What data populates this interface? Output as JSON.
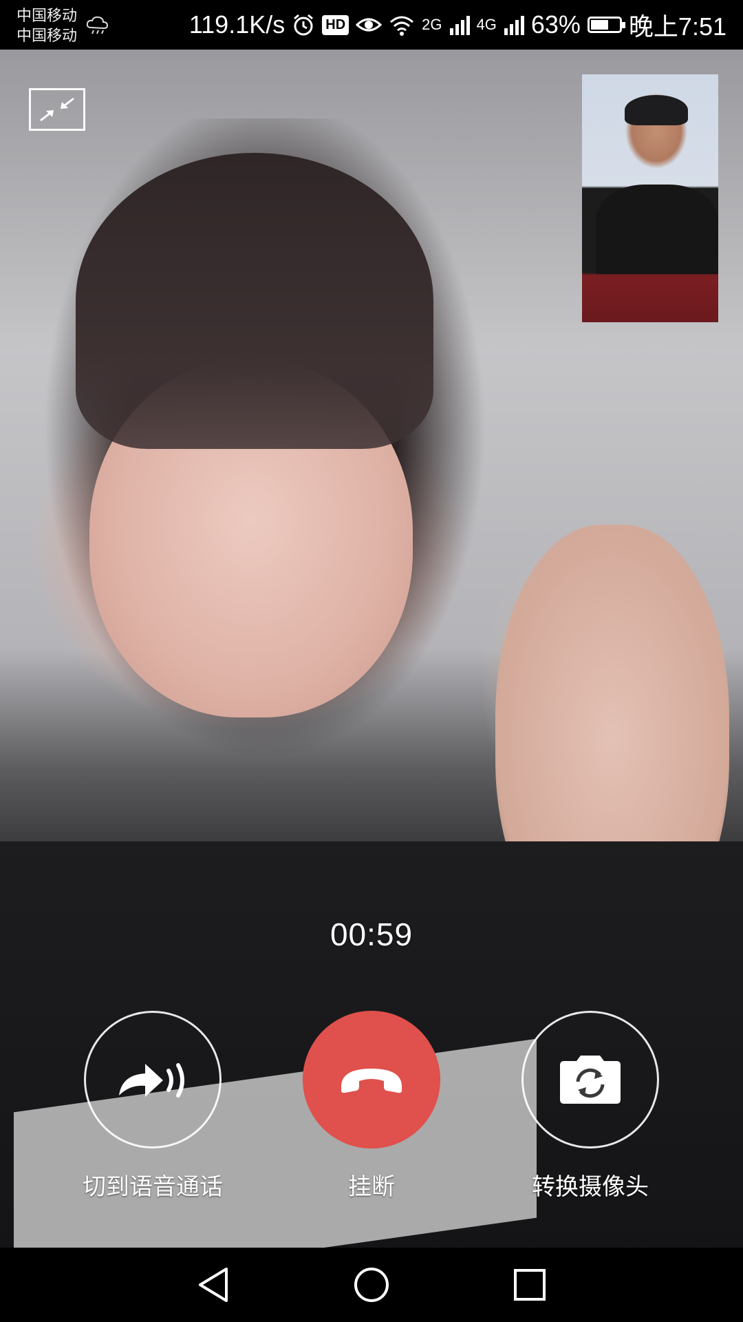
{
  "status_bar": {
    "carrier_1": "中国移动",
    "carrier_2": "中国移动",
    "network_speed": "119.1K/s",
    "hd_badge": "HD",
    "signal_1_label": "2G",
    "signal_2_label": "4G",
    "battery_percent": "63%",
    "battery_level": 0.63,
    "time": "晚上7:51",
    "icons": [
      "weather-rain-icon",
      "alarm-icon",
      "hd-icon",
      "eye-icon",
      "wifi-icon",
      "signal-icon",
      "battery-icon"
    ]
  },
  "call": {
    "timer": "00:59"
  },
  "controls": {
    "switch_to_voice_label": "切到语音通话",
    "hang_up_label": "挂断",
    "switch_camera_label": "转换摄像头",
    "hang_up_color": "#e0504c"
  },
  "navbar": {
    "icons": [
      "back-icon",
      "home-icon",
      "recents-icon"
    ]
  }
}
